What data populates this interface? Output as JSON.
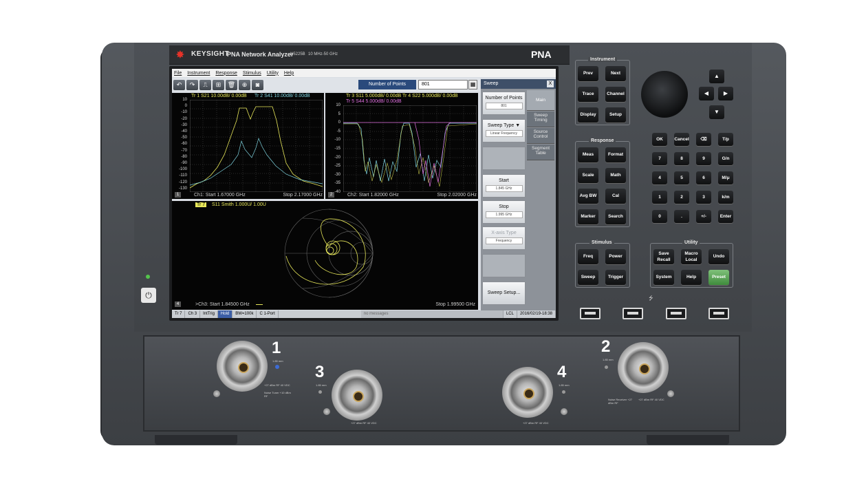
{
  "brand": {
    "logo": "KEYSIGHT",
    "title": "PNA Network Analyzer",
    "model": "N5225B",
    "range": "10 MHz-50 GHz",
    "badge": "PNA"
  },
  "menu": [
    "File",
    "Instrument",
    "Response",
    "Stimulus",
    "Utility",
    "Help"
  ],
  "toolbar": {
    "icons": [
      "undo-icon",
      "redo-icon",
      "marker-icon",
      "autoscale-icon",
      "delete-icon",
      "zoom-icon",
      "camera-icon"
    ],
    "active_label": "Number of Points",
    "active_value": "801",
    "keypad_icon": "keypad-icon"
  },
  "sidepanel": {
    "title": "Sweep",
    "close": "X",
    "buttons": [
      {
        "label": "Number of Points",
        "value": "801",
        "enabled": true
      },
      {
        "label": "Sweep Type ▼",
        "value": "Linear Frequency",
        "enabled": true
      },
      {
        "label": "",
        "value": "",
        "enabled": false,
        "blank": true
      },
      {
        "label": "Start",
        "value": "1.845 GHz",
        "enabled": true
      },
      {
        "label": "Stop",
        "value": "1.995 GHz",
        "enabled": true
      },
      {
        "label": "X-axis Type",
        "value": "Frequency",
        "enabled": false
      },
      {
        "label": "",
        "value": "",
        "enabled": false,
        "blank": true
      },
      {
        "label": "Sweep Setup...",
        "value": "",
        "enabled": true
      }
    ],
    "tabs": [
      "Main",
      "Sweep Timing",
      "Source Control",
      "Segment Table"
    ]
  },
  "charts": {
    "ch1": {
      "header1": "Tr 1  S21 10.00dB/ 0.00dB",
      "header2": "Tr 2  S41 10.00dB/ 0.00dB",
      "y_ticks": [
        "10",
        "0",
        "-10",
        "-20",
        "-30",
        "-40",
        "-50",
        "-60",
        "-70",
        "-80",
        "-90",
        "-100",
        "-110",
        "-120",
        "-130"
      ],
      "start": "Ch1: Start  1.67000 GHz",
      "stop": "Stop  2.17000 GHz",
      "num": "1"
    },
    "ch2": {
      "header1": "Tr 3  S11 5.000dB/ 0.00dB   Tr 4  S22 5.000dB/ 0.00dB",
      "header2": "Tr 5  S44 5.000dB/ 0.00dB",
      "y_ticks": [
        "10",
        "5",
        "0",
        "-5",
        "-10",
        "-15",
        "-20",
        "-25",
        "-30",
        "-35",
        "-40"
      ],
      "start": "Ch2: Start  1.82000 GHz",
      "stop": "Stop  2.02000 GHz",
      "num": "2"
    },
    "ch3": {
      "trace_tag": "Tr 7",
      "header": "S11 Smith 1.000U/ 1.00U",
      "start": ">Ch3: Start  1.84500 GHz",
      "stop": "Stop  1.99500 GHz",
      "num": "4"
    }
  },
  "statusbar": [
    "Tr 7",
    "Ch 3",
    "IntTrig",
    "Hold",
    "BW=100k",
    "C  1-Port",
    "no messages",
    "LCL",
    "2016/02/19-18:38"
  ],
  "panel": {
    "instrument": {
      "title": "Instrument",
      "keys": [
        "Prev",
        "Next",
        "Trace",
        "Channel",
        "Display",
        "Setup"
      ]
    },
    "response": {
      "title": "Response",
      "keys": [
        "Meas",
        "Format",
        "Scale",
        "Math",
        "Avg BW",
        "Cal",
        "Marker",
        "Search"
      ]
    },
    "stimulus": {
      "title": "Stimulus",
      "keys": [
        "Freq",
        "Power",
        "Sweep",
        "Trigger"
      ]
    },
    "utility": {
      "title": "Utility",
      "keys": [
        "Save Recall",
        "Macro Local",
        "Undo",
        "System",
        "Help",
        "Preset"
      ]
    },
    "entry": [
      "OK",
      "Cancel",
      "⌫",
      "T/p",
      "7",
      "8",
      "9",
      "G/n",
      "4",
      "5",
      "6",
      "M/μ",
      "1",
      "2",
      "3",
      "k/m",
      "0",
      ".",
      "+/-",
      "Enter"
    ],
    "arrows": [
      "▲",
      "◀",
      "▶",
      "▼"
    ]
  },
  "ports": {
    "p1": "1",
    "p2": "2",
    "p3": "3",
    "p4": "4",
    "conn": "1.85 mm",
    "note1": "+27 dBm RF 40 VDC",
    "note2": "Noise Tuner +10 dBm RF",
    "note3": "Noise Receiver +27 dBm RF"
  }
}
